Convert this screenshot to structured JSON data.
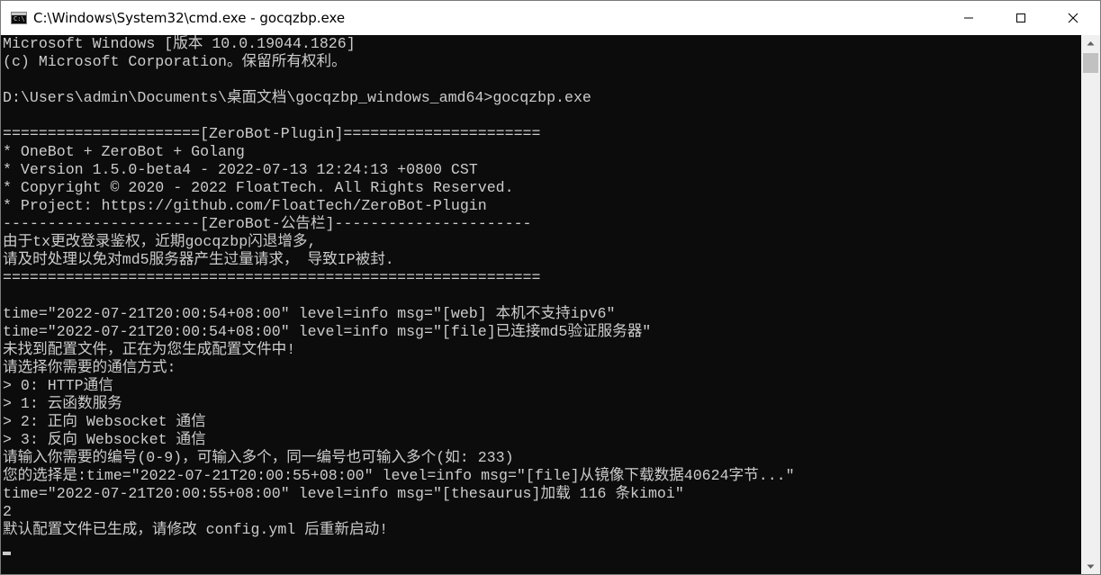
{
  "window": {
    "title": "C:\\Windows\\System32\\cmd.exe - gocqzbp.exe",
    "icon": "cmd-icon",
    "icon_glyph": "C:\\"
  },
  "controls": {
    "minimize": "minimize-icon",
    "maximize": "maximize-icon",
    "close": "close-icon"
  },
  "terminal": {
    "lines": [
      "Microsoft Windows [版本 10.0.19044.1826]",
      "(c) Microsoft Corporation。保留所有权利。",
      "",
      "D:\\Users\\admin\\Documents\\桌面文档\\gocqzbp_windows_amd64>gocqzbp.exe",
      "",
      "======================[ZeroBot-Plugin]======================",
      "* OneBot + ZeroBot + Golang",
      "* Version 1.5.0-beta4 - 2022-07-13 12:24:13 +0800 CST",
      "* Copyright © 2020 - 2022 FloatTech. All Rights Reserved.",
      "* Project: https://github.com/FloatTech/ZeroBot-Plugin",
      "----------------------[ZeroBot-公告栏]----------------------",
      "由于tx更改登录鉴权，近期gocqzbp闪退增多,",
      "请及时处理以免对md5服务器产生过量请求， 导致IP被封.",
      "============================================================",
      "",
      "time=\"2022-07-21T20:00:54+08:00\" level=info msg=\"[web] 本机不支持ipv6\"",
      "time=\"2022-07-21T20:00:54+08:00\" level=info msg=\"[file]已连接md5验证服务器\"",
      "未找到配置文件，正在为您生成配置文件中!",
      "请选择你需要的通信方式:",
      "> 0: HTTP通信",
      "> 1: 云函数服务",
      "> 2: 正向 Websocket 通信",
      "> 3: 反向 Websocket 通信",
      "请输入你需要的编号(0-9)，可输入多个，同一编号也可输入多个(如: 233)",
      "您的选择是:time=\"2022-07-21T20:00:55+08:00\" level=info msg=\"[file]从镜像下载数据40624字节...\"",
      "time=\"2022-07-21T20:00:55+08:00\" level=info msg=\"[thesaurus]加载 116 条kimoi\"",
      "2",
      "默认配置文件已生成，请修改 config.yml 后重新启动!"
    ]
  },
  "scrollbar": {
    "up": "scroll-up-arrow-icon",
    "down": "scroll-down-arrow-icon"
  },
  "colors": {
    "terminal_bg": "#0c0c0c",
    "terminal_fg": "#cccccc",
    "titlebar_bg": "#ffffff"
  }
}
